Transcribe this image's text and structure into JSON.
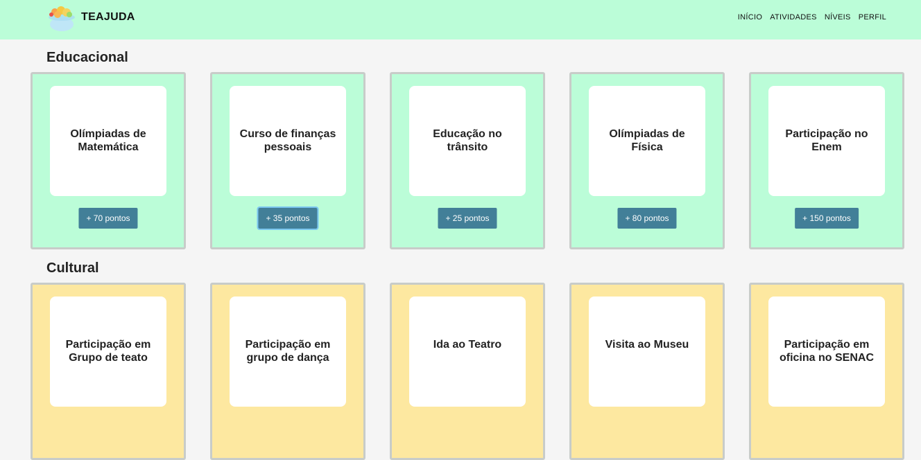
{
  "header": {
    "brand": "TEAJUDA",
    "nav": [
      "INÍCIO",
      "ATIVIDADES",
      "NÍVEIS",
      "PERFIL"
    ]
  },
  "sections": [
    {
      "title": "Educacional",
      "color": "#bbfdd8",
      "cards": [
        {
          "title": "Olímpiadas de Matemática",
          "points": "+ 70 pontos"
        },
        {
          "title": "Curso de finanças pessoais",
          "points": "+ 35 pontos"
        },
        {
          "title": "Educação no trânsito",
          "points": "+ 25 pontos"
        },
        {
          "title": "Olímpiadas de Física",
          "points": "+ 80 pontos"
        },
        {
          "title": "Participação no Enem",
          "points": "+ 150 pontos"
        }
      ]
    },
    {
      "title": "Cultural",
      "color": "#fde8a0",
      "cards": [
        {
          "title": "Participação em Grupo de teato"
        },
        {
          "title": "Participação em grupo de dança"
        },
        {
          "title": "Ida ao Teatro"
        },
        {
          "title": "Visita ao Museu"
        },
        {
          "title": "Participação em oficina no SENAC"
        }
      ]
    }
  ],
  "colors": {
    "button": "#427f98",
    "header": "#bbfdd8",
    "focus_ring": "#7bc7f0"
  }
}
